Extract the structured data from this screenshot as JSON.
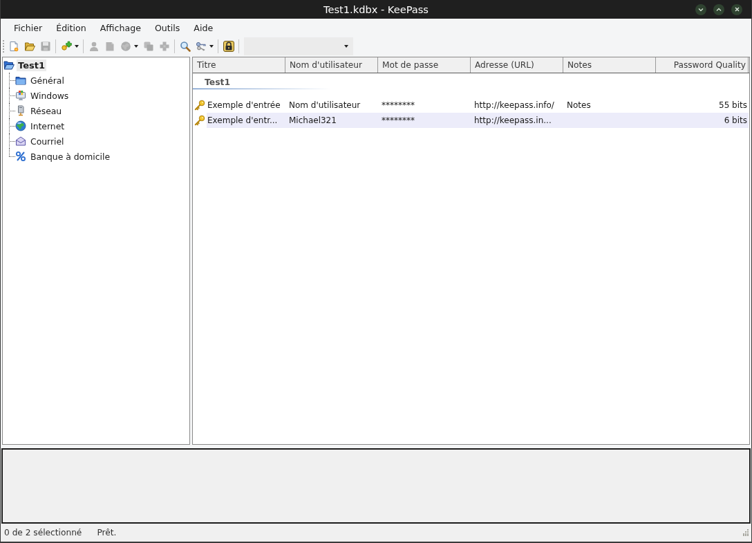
{
  "window": {
    "title": "Test1.kdbx - KeePass"
  },
  "menu": [
    "Fichier",
    "Édition",
    "Affichage",
    "Outils",
    "Aide"
  ],
  "toolbar": {
    "groups": [
      [
        {
          "disabled": false,
          "has_menu": false
        },
        {
          "disabled": false,
          "has_menu": false
        },
        {
          "disabled": true,
          "has_menu": false
        }
      ],
      [
        {
          "disabled": false,
          "has_menu": true
        }
      ],
      [
        {
          "disabled": true,
          "has_menu": false
        },
        {
          "disabled": true,
          "has_menu": false
        },
        {
          "disabled": true,
          "has_menu": true
        },
        {
          "disabled": true,
          "has_menu": false
        },
        {
          "disabled": true,
          "has_menu": false
        }
      ],
      [
        {
          "disabled": false,
          "has_menu": false
        },
        {
          "disabled": false,
          "has_menu": true
        }
      ],
      [
        {
          "disabled": false,
          "has_menu": false
        }
      ]
    ],
    "search": {
      "disabled": true
    }
  },
  "tree": {
    "label": "Test1",
    "selected": true,
    "children": [
      {
        "label": "Général",
        "selected": false
      },
      {
        "label": "Windows",
        "selected": false
      },
      {
        "label": "Réseau",
        "selected": false
      },
      {
        "label": "Internet",
        "selected": false
      },
      {
        "label": "Courriel",
        "selected": false
      },
      {
        "label": "Banque à domicile",
        "selected": false
      }
    ]
  },
  "entry_list": {
    "columns": [
      "Titre",
      "Nom d'utilisateur",
      "Mot de passe",
      "Adresse (URL)",
      "Notes",
      "Password Quality"
    ],
    "groups": [
      {
        "name": "Test1",
        "entries": [
          {
            "title": "Exemple d'entrée",
            "username": "Nom d'utilisateur",
            "password": "********",
            "url": "http://keepass.info/",
            "notes": "Notes",
            "quality": "55 bits",
            "hovered": false
          },
          {
            "title": "Exemple d'entr...",
            "username": "Michael321",
            "password": "********",
            "url": "http://keepass.in...",
            "quality": "6 bits",
            "hovered": true
          }
        ]
      }
    ]
  },
  "status_bar": [
    "0 de 2 sélectionné",
    "Prêt."
  ]
}
